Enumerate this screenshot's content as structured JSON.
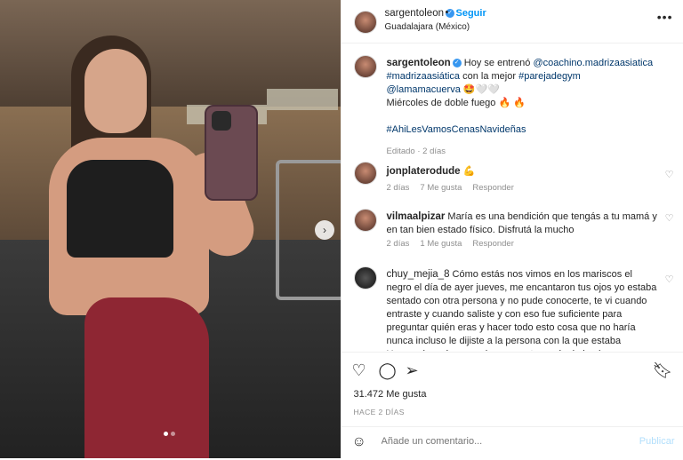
{
  "post": {
    "username": "sargentoleon",
    "follow_label": "Seguir",
    "location": "Guadalajara (México)",
    "more_icon": "•••"
  },
  "caption": {
    "username": "sargentoleon",
    "text_pre": "Hoy se entrenó ",
    "mention1": "@coachino.madrizaasiatica",
    "tag1": "#madrizaasiática",
    "text_mid": " con la mejor ",
    "tag2": "#parejadegym",
    "mention2": "@lamamacuerva",
    "emoji_line": "🤩🤍🤍",
    "line2": "Miércoles de doble fuego 🔥 🔥",
    "tag3": "#AhiLesVamosCenasNavideñas",
    "edited": "Editado · 2 días"
  },
  "comments": [
    {
      "username": "jonplaterodude",
      "text": "💪",
      "time": "2 días",
      "likes": "7 Me gusta",
      "reply": "Responder"
    },
    {
      "username": "vilmaalpizar",
      "text": "María es una bendición que tengás a tu mamá y en tan bien estado físico. Disfrutá la mucho",
      "time": "2 días",
      "likes": "1 Me gusta",
      "reply": "Responder"
    },
    {
      "username": "chuy_mejia_8",
      "text": "Cómo estás nos vimos en los mariscos el negro el día de ayer jueves, me encantaron tus ojos yo estaba sentado con otra persona y no pude conocerte, te vi cuando entraste y cuando saliste y con eso fue suficiente para preguntar quién eras y hacer todo esto cosa que no haría nunca incluso le dijiste a la persona con la que estaba Unrovecho, cómo puedo conocerte maría de hecho"
    }
  ],
  "actions": {
    "likes": "31.472 Me gusta",
    "ago": "HACE 2 DÍAS",
    "comment_placeholder": "Añade un comentario...",
    "publish": "Publicar"
  },
  "colors": {
    "accent": "#0095f6",
    "publish_disabled": "#b2dffc",
    "link": "#00376b"
  }
}
